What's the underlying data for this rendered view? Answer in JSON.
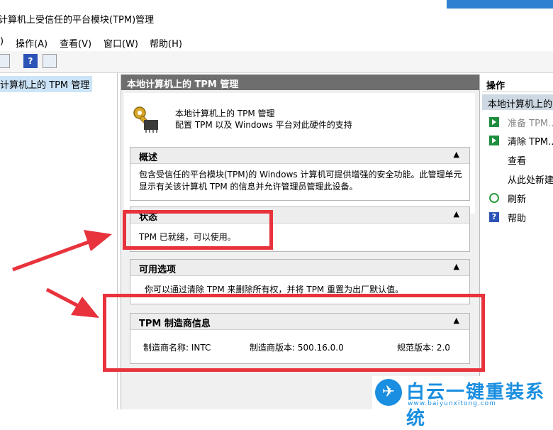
{
  "window": {
    "title": "计算机上受信任的平台模块(TPM)管理"
  },
  "menu": [
    {
      "label": ")"
    },
    {
      "label": "操作(A)"
    },
    {
      "label": "查看(V)"
    },
    {
      "label": "窗口(W)"
    },
    {
      "label": "帮助(H)"
    }
  ],
  "toolbar": {
    "help_glyph": "?"
  },
  "tree": {
    "selected_label": "计算机上的 TPM 管理"
  },
  "center": {
    "header": "本地计算机上的 TPM 管理",
    "intro_title": "本地计算机上的 TPM 管理",
    "intro_desc": "配置 TPM 以及 Windows 平台对此硬件的支持",
    "sections": {
      "overview": {
        "title": "概述",
        "body": "包含受信任的平台模块(TPM)的 Windows 计算机可提供增强的安全功能。此管理单元显示有关该计算机 TPM 的信息并允许管理员管理此设备。"
      },
      "status": {
        "title": "状态",
        "body": "TPM 已就绪，可以使用。"
      },
      "options": {
        "title": "可用选项",
        "body": "你可以通过清除 TPM 来删除所有权，并将 TPM 重置为出厂默认值。"
      },
      "manufacturer": {
        "title": "TPM 制造商信息",
        "name": "制造商名称: INTC",
        "version": "制造商版本: 500.16.0.0",
        "spec": "规范版本: 2.0"
      }
    },
    "collapse_glyph": "▲"
  },
  "actions": {
    "header": "操作",
    "subheader": "本地计算机上的",
    "items": [
      {
        "label": "准备 TPM...",
        "icon": "green-arrow-icon",
        "disabled": true
      },
      {
        "label": "清除 TPM...",
        "icon": "green-arrow-icon",
        "disabled": false
      },
      {
        "label": "查看",
        "icon": "",
        "disabled": false
      },
      {
        "label": "从此处新建",
        "icon": "",
        "disabled": false
      },
      {
        "label": "刷新",
        "icon": "refresh-icon",
        "disabled": false
      },
      {
        "label": "帮助",
        "icon": "help-icon",
        "disabled": false
      }
    ]
  },
  "watermark": {
    "brand": "白云一键重装系统",
    "url": "www.baiyunxitong.com"
  },
  "colors": {
    "highlight_red": "#e8323c",
    "header_gray": "#6e6e6e",
    "selection_blue": "#cce4f7",
    "brand_blue": "#1a8ee0"
  }
}
